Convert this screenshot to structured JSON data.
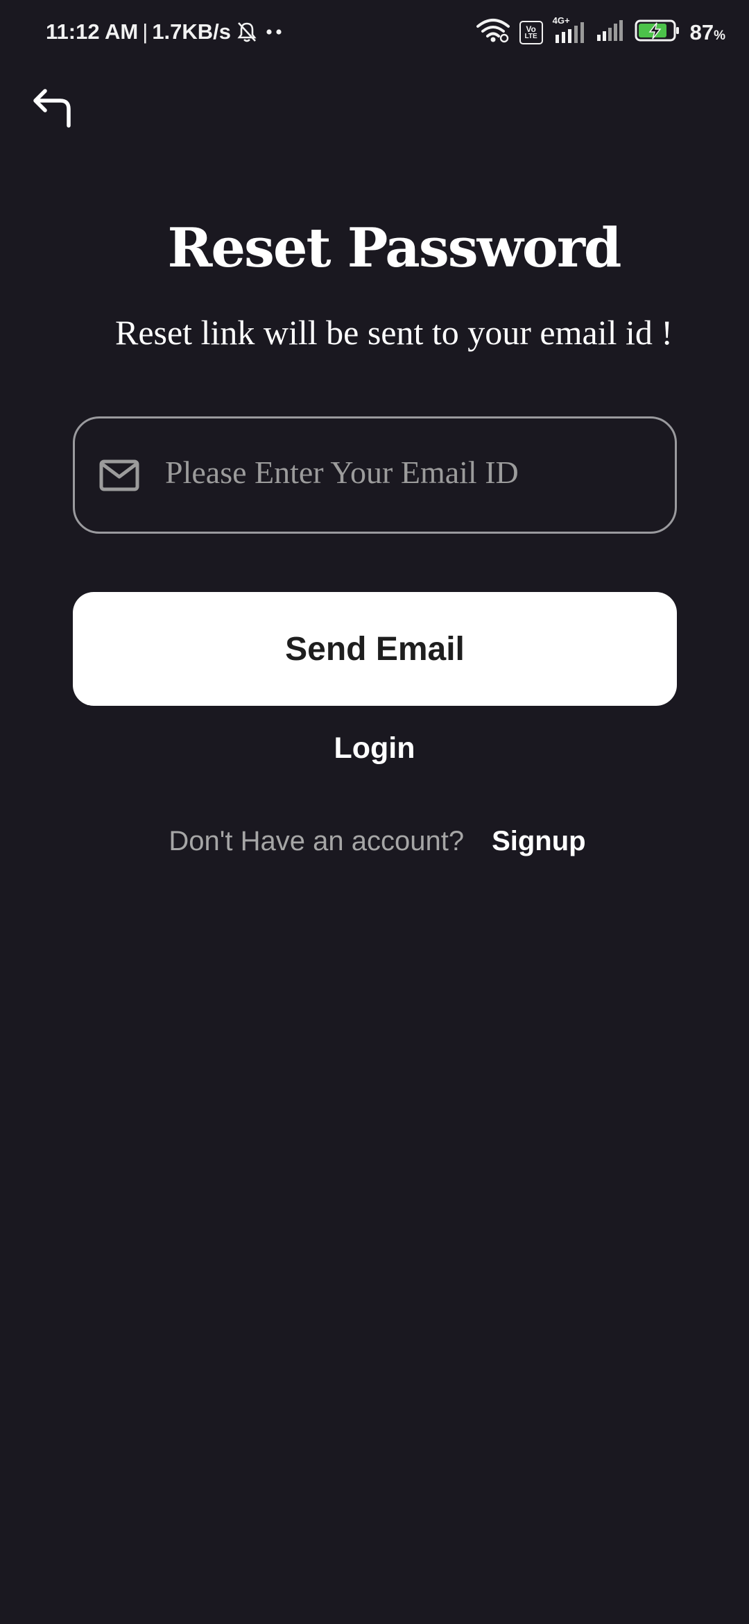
{
  "status_bar": {
    "time": "11:12 AM",
    "separator": "|",
    "network_speed": "1.7KB/s",
    "battery_percent": "87",
    "battery_unit": "%",
    "volte_label_top": "Vo",
    "volte_label_bottom": "LTE",
    "network_type": "4G+",
    "icons": [
      "mute-bell-icon",
      "more-dots-icon",
      "wifi-icon",
      "volte-icon",
      "signal-icon",
      "signal-icon-secondary",
      "battery-charging-icon"
    ],
    "battery_color": "#4cc24a"
  },
  "header": {
    "back_icon": "back-arrow-icon"
  },
  "main": {
    "title": "Reset Password",
    "subtitle": "Reset link will be sent to your email id !",
    "email_field": {
      "icon": "mail-icon",
      "value": "",
      "placeholder": "Please Enter Your Email ID"
    },
    "send_button_label": "Send Email",
    "login_label": "Login",
    "signup_prompt": "Don't Have an account?",
    "signup_label": "Signup"
  },
  "colors": {
    "background": "#1a1820",
    "primary_button": "#ffffff",
    "text": "#ffffff",
    "muted_text": "#a6a6a6",
    "field_border": "#9a9a9e"
  }
}
